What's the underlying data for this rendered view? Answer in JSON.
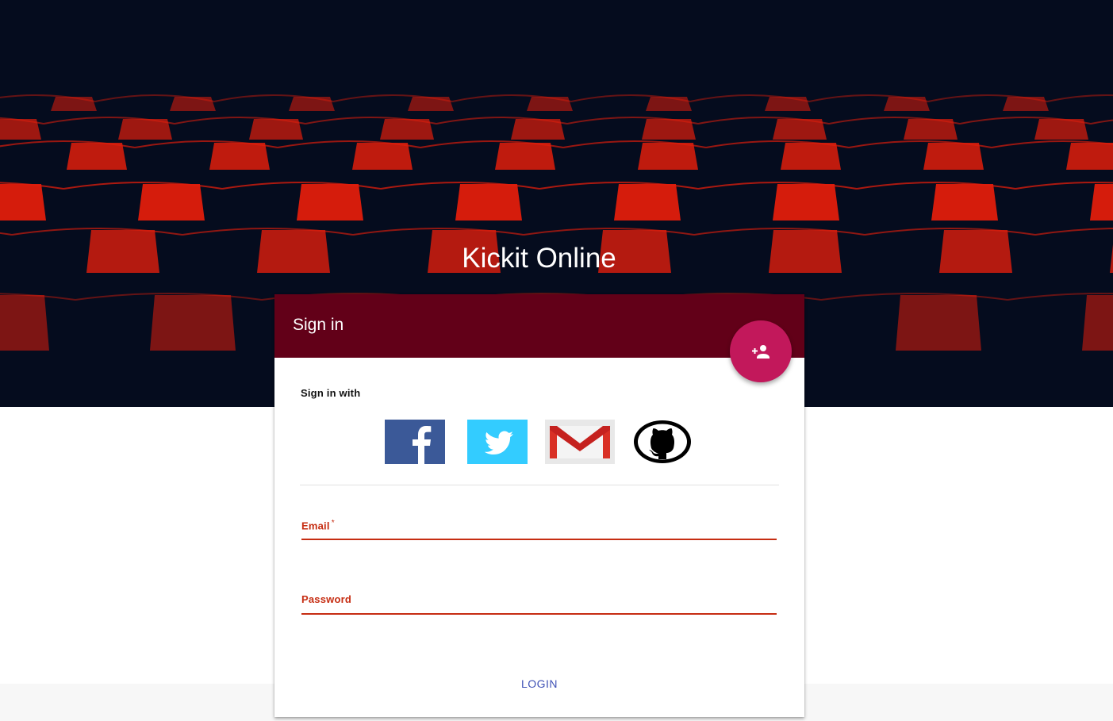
{
  "site": {
    "title": "Kickit Online"
  },
  "card": {
    "header_title": "Sign in",
    "add_user_icon": "person-add-icon",
    "signin_with_label": "Sign in with",
    "social_providers": [
      {
        "name": "Facebook",
        "icon": "facebook-icon",
        "color": "#3b5998"
      },
      {
        "name": "Twitter",
        "icon": "twitter-icon",
        "color": "#33ccff"
      },
      {
        "name": "Gmail",
        "icon": "gmail-icon",
        "color": "#d93025"
      },
      {
        "name": "GitHub",
        "icon": "github-icon",
        "color": "#000000"
      }
    ],
    "email": {
      "label": "Email",
      "required_mark": "*",
      "value": ""
    },
    "password": {
      "label": "Password",
      "value": ""
    },
    "login_label": "LOGIN"
  },
  "colors": {
    "header": "#620018",
    "fab": "#c2185b",
    "field_accent": "#c62d12",
    "login_text": "#3f51b5",
    "hero_background": "#050c1e",
    "seat_red": "#e01e0c"
  }
}
